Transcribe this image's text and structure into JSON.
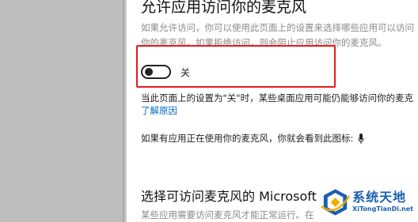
{
  "page": {
    "title": "允许应用访问你的麦克风",
    "description": "如果允许访问，你可以使用此页面上的设置来选择哪些应用可以访问你的麦克风。如果拒绝访问，则会阻止应用访问你的麦克风。",
    "toggle": {
      "state": "off",
      "label": "关"
    },
    "note": "当此页面上的设置为\"关\"时，某些桌面应用可能仍能够访问你的麦克",
    "learn_more_link": "了解原因",
    "indicator_text": "如果有应用正在使用你的麦克风，你就会看到此图标:",
    "indicator_icon": "microphone-icon",
    "section_title": "选择可访问麦克风的 Microsoft",
    "section_desc": "某些应用需要访问麦克风才能正常运行。在"
  },
  "watermark": {
    "text": "系统天地",
    "url": "XiTongTianDi.net"
  },
  "colors": {
    "highlight": "#e51b1b",
    "link": "#0067c0",
    "watermark": "#1a5fb4"
  }
}
